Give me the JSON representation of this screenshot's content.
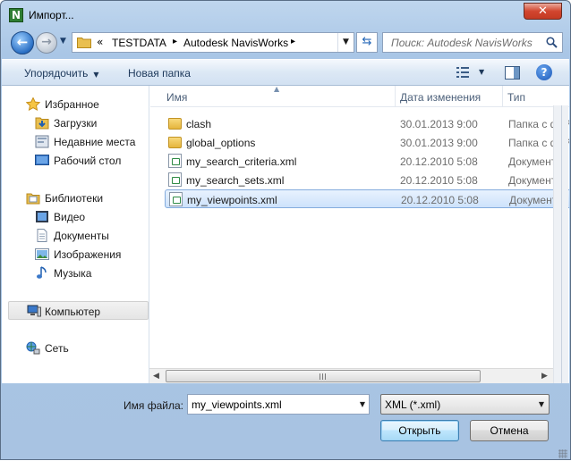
{
  "window": {
    "title": "Импорт...",
    "app_icon_letter": "N",
    "close_symbol": "✕"
  },
  "nav": {
    "back_symbol": "←",
    "forward_symbol": "→",
    "history_symbol": "▼",
    "address": {
      "overflow": "«",
      "crumbs": [
        "TESTDATA",
        "Autodesk NavisWorks"
      ],
      "separator": "▸"
    },
    "refresh_symbol": "⇆",
    "search_placeholder": "Поиск: Autodesk NavisWorks"
  },
  "toolbar": {
    "organize_label": "Упорядочить",
    "new_folder_label": "Новая папка",
    "help_symbol": "?"
  },
  "sidebar": {
    "items": [
      {
        "label": "Избранное",
        "icon": "star-icon"
      },
      {
        "label": "Загрузки",
        "icon": "downloads-icon"
      },
      {
        "label": "Недавние места",
        "icon": "recent-places-icon"
      },
      {
        "label": "Рабочий стол",
        "icon": "desktop-icon"
      },
      {
        "label": "Библиотеки",
        "icon": "libraries-icon"
      },
      {
        "label": "Видео",
        "icon": "video-icon"
      },
      {
        "label": "Документы",
        "icon": "documents-icon"
      },
      {
        "label": "Изображения",
        "icon": "pictures-icon"
      },
      {
        "label": "Музыка",
        "icon": "music-icon"
      },
      {
        "label": "Компьютер",
        "icon": "computer-icon"
      },
      {
        "label": "Сеть",
        "icon": "network-icon"
      }
    ]
  },
  "files": {
    "columns": [
      "Имя",
      "Дата изменения",
      "Тип"
    ],
    "rows": [
      {
        "name": "clash",
        "date": "30.01.2013 9:00",
        "type": "Папка с фай",
        "kind": "folder"
      },
      {
        "name": "global_options",
        "date": "30.01.2013 9:00",
        "type": "Папка с фай",
        "kind": "folder"
      },
      {
        "name": "my_search_criteria.xml",
        "date": "20.12.2010 5:08",
        "type": "Документ X",
        "kind": "xml"
      },
      {
        "name": "my_search_sets.xml",
        "date": "20.12.2010 5:08",
        "type": "Документ X",
        "kind": "xml"
      },
      {
        "name": "my_viewpoints.xml",
        "date": "20.12.2010 5:08",
        "type": "Документ X",
        "kind": "xml"
      }
    ],
    "selected_index": 4
  },
  "scroll": {
    "left_symbol": "◀",
    "right_symbol": "▶"
  },
  "bottom": {
    "filename_label": "Имя файла:",
    "filename_value": "my_viewpoints.xml",
    "filetype_value": "XML (*.xml)",
    "open_label": "Открыть",
    "cancel_label": "Отмена",
    "dropdown_symbol": "▼"
  },
  "colors": {
    "selection": "#cde2fb",
    "frame": "#a9c6e6",
    "close": "#d2462f"
  }
}
